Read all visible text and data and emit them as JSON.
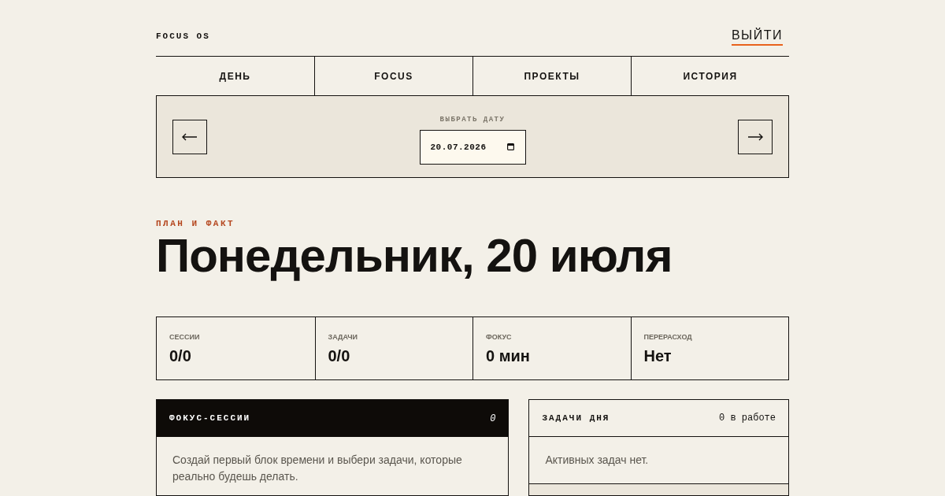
{
  "header": {
    "brand": "FOCUS OS",
    "logout": "ВЫЙТИ"
  },
  "tabs": [
    {
      "label": "ДЕНЬ",
      "selected": false
    },
    {
      "label": "FOCUS",
      "selected": false
    },
    {
      "label": "ПРОЕКТЫ",
      "selected": false
    },
    {
      "label": "ИСТОРИЯ",
      "selected": false
    }
  ],
  "date_picker": {
    "label": "ВЫБРАТЬ ДАТУ",
    "value": "20.07.2026"
  },
  "eyebrow": "ПЛАН И ФАКТ",
  "title": "Понедельник, 20 июля",
  "stats": [
    {
      "label": "СЕССИИ",
      "value": "0/0"
    },
    {
      "label": "ЗАДАЧИ",
      "value": "0/0"
    },
    {
      "label": "ФОКУС",
      "value": "0 мин"
    },
    {
      "label": "ПЕРЕРАСХОД",
      "value": "Нет"
    }
  ],
  "sessions_panel": {
    "title": "ФОКУС-СЕССИИ",
    "count": "0",
    "empty_text": "Создай первый блок времени и выбери задачи, которые реально будешь делать."
  },
  "tasks_panel": {
    "title": "ЗАДАЧИ ДНЯ",
    "count": "0 в работе",
    "empty_text": "Активных задач нет."
  }
}
